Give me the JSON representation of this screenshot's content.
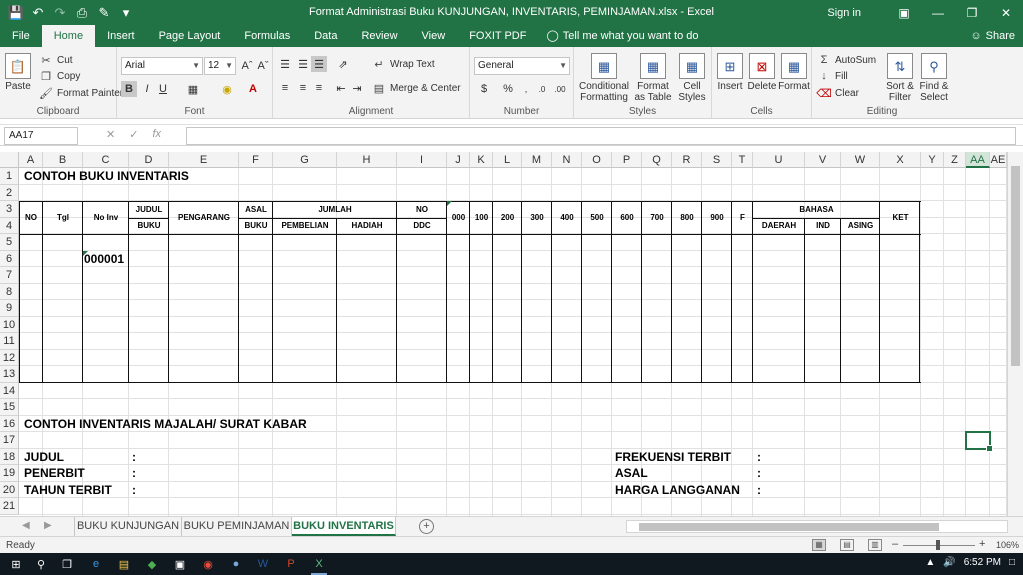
{
  "window": {
    "title": "Format Administrasi Buku KUNJUNGAN, INVENTARIS, PEMINJAMAN.xlsx  -  Excel",
    "signin": "Sign in"
  },
  "ribbon_tabs": [
    "File",
    "Home",
    "Insert",
    "Page Layout",
    "Formulas",
    "Data",
    "Review",
    "View",
    "FOXIT PDF"
  ],
  "tellme": "Tell me what you want to do",
  "share": "Share",
  "ribbon": {
    "clipboard": {
      "paste": "Paste",
      "cut": "Cut",
      "copy": "Copy",
      "format_painter": "Format Painter",
      "label": "Clipboard"
    },
    "font": {
      "name": "Arial",
      "size": "12",
      "label": "Font"
    },
    "alignment": {
      "wrap": "Wrap Text",
      "merge": "Merge & Center",
      "label": "Alignment"
    },
    "number": {
      "format": "General",
      "label": "Number"
    },
    "styles": {
      "conditional": "Conditional Formatting",
      "format_table": "Format as Table",
      "cell_styles": "Cell Styles",
      "label": "Styles"
    },
    "cells": {
      "insert": "Insert",
      "delete": "Delete",
      "format": "Format",
      "label": "Cells"
    },
    "editing": {
      "autosum": "AutoSum",
      "fill": "Fill",
      "clear": "Clear",
      "sort": "Sort & Filter",
      "find": "Find & Select",
      "label": "Editing"
    }
  },
  "formula_bar": {
    "name_box": "AA17",
    "fx": "fx",
    "value": ""
  },
  "columns": [
    "A",
    "B",
    "C",
    "D",
    "E",
    "F",
    "G",
    "H",
    "I",
    "J",
    "K",
    "L",
    "M",
    "N",
    "O",
    "P",
    "Q",
    "R",
    "S",
    "T",
    "U",
    "V",
    "W",
    "X",
    "Y",
    "Z",
    "AA",
    "AE"
  ],
  "selected_column": "AA",
  "rows": [
    "1",
    "2",
    "3",
    "4",
    "5",
    "6",
    "7",
    "8",
    "9",
    "10",
    "11",
    "12",
    "13",
    "14",
    "15",
    "16",
    "17",
    "18",
    "19",
    "20",
    "21"
  ],
  "sheet": {
    "title1": "CONTOH BUKU INVENTARIS",
    "headers": {
      "no": "NO",
      "tgl": "Tgl",
      "noinv": "No Inv",
      "judul": "JUDUL",
      "buku": "BUKU",
      "pengarang": "PENGARANG",
      "asal": "ASAL",
      "asal2": "BUKU",
      "jumlah": "JUMLAH",
      "pembelian": "PEMBELIAN",
      "hadiah": "HADIAH",
      "noddc1": "NO",
      "noddc2": "DDC",
      "c000": "000",
      "c100": "100",
      "c200": "200",
      "c300": "300",
      "c400": "400",
      "c500": "500",
      "c600": "600",
      "c700": "700",
      "c800": "800",
      "c900": "900",
      "f": "F",
      "bahasa": "BAHASA",
      "daerah": "DAERAH",
      "ind": "IND",
      "asing": "ASING",
      "ket": "KET"
    },
    "c6": "000001",
    "title2": "CONTOH INVENTARIS MAJALAH/ SURAT KABAR",
    "judul": "JUDUL",
    "penerbit": "PENERBIT",
    "tahun": "TAHUN TERBIT",
    "frekuensi": "FREKUENSI TERBIT",
    "asal": "ASAL",
    "harga": "HARGA LANGGANAN",
    "colon": ":"
  },
  "sheet_tabs": [
    "BUKU KUNJUNGAN",
    "BUKU PEMINJAMAN",
    "BUKU INVENTARIS"
  ],
  "status": {
    "ready": "Ready",
    "zoom": "106%"
  },
  "taskbar": {
    "time": "6:52 PM"
  }
}
